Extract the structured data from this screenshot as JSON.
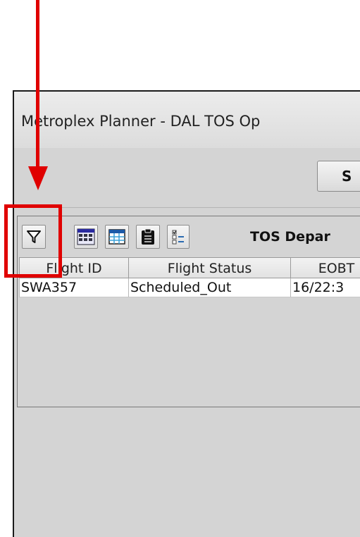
{
  "window": {
    "title": "Metroplex Planner - DAL TOS Op"
  },
  "top_buttons": {
    "partial_label": "S"
  },
  "toolbar": {
    "buttons": [
      {
        "name": "filter-button",
        "icon": "filter-icon"
      },
      {
        "name": "columns-button",
        "icon": "grid-select-icon"
      },
      {
        "name": "table-view-button",
        "icon": "table-icon"
      },
      {
        "name": "clipboard-button",
        "icon": "clipboard-icon"
      },
      {
        "name": "checklist-button",
        "icon": "checklist-icon"
      }
    ],
    "panel_title": "TOS Depar"
  },
  "table": {
    "columns": [
      "Flight ID",
      "Flight Status",
      "EOBT"
    ],
    "rows": [
      [
        "SWA357",
        "Scheduled_Out",
        "16/22:3"
      ]
    ]
  },
  "annotation": {
    "color": "#e00000"
  }
}
